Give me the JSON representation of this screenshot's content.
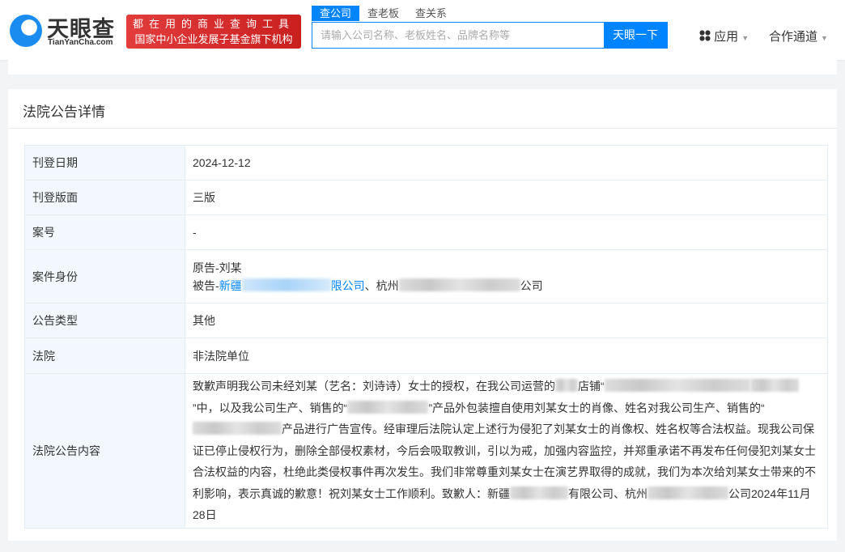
{
  "header": {
    "logo_name": "天眼查",
    "logo_domain": "TianYanCha.com",
    "slogan_line1": "都在用的商业查询工具",
    "slogan_line2": "国家中小企业发展子基金旗下机构",
    "search_tabs": [
      "查公司",
      "查老板",
      "查关系"
    ],
    "search_placeholder": "请输入公司名称、老板姓名、品牌名称等",
    "search_button": "天眼一下",
    "apps": "应用",
    "partner": "合作通道"
  },
  "card": {
    "title": "法院公告详情",
    "rows": [
      {
        "label": "刊登日期",
        "value": "2024-12-12"
      },
      {
        "label": "刊登版面",
        "value": "三版"
      },
      {
        "label": "案号",
        "value": "-"
      },
      {
        "label": "案件身份",
        "plaintiff": "原告-刘某",
        "defendant_prefix": "被告-",
        "defendant1_a": "新疆",
        "defendant1_b": "限公司",
        "sep": "、",
        "defendant2_a": "杭州",
        "defendant2_b": "公司"
      },
      {
        "label": "公告类型",
        "value": "其他"
      },
      {
        "label": "法院",
        "value": "非法院单位"
      },
      {
        "label": "法院公告内容",
        "seg1": "致歉声明我公司未经刘某（艺名：刘诗诗）女士的授权，在我公司运营的",
        "seg2": "店铺“",
        "seg3": "”中，以及我公司生产、销售的“",
        "seg4": "”产品外包装擅自使用刘某女士的肖像、姓名对我公司生产、销售的“",
        "seg5": "产品进行广告宣传。经审理后法院认定上述行为侵犯了刘某女士的肖像权、姓名权等合法权益。现我公司保证已停止侵权行为，删除全部侵权素材，今后会吸取教训，引以为戒，加强内容监控，并郑重承诺不再发布任何侵犯刘某女士合法权益的内容，杜绝此类侵权事件再次发生。我们非常尊重刘某女士在演艺界取得的成就，我们为本次给刘某女士带来的不利影响，表示真诚的歉意！祝刘某女士工作顺利。致歉人：新疆",
        "seg6": "有限公司、杭州",
        "seg7": "公司2024年11月28日"
      }
    ]
  }
}
